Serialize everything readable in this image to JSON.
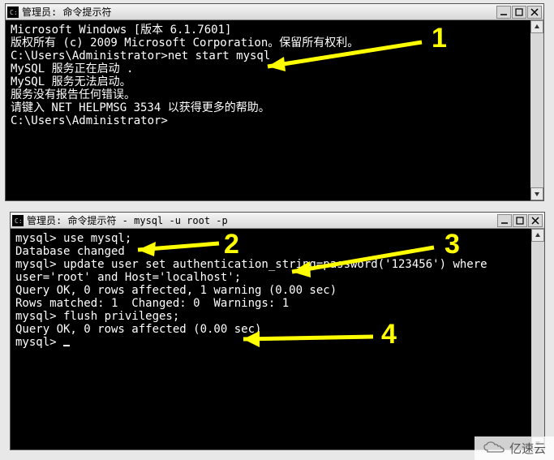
{
  "windows": [
    {
      "title": "管理员: 命令提示符",
      "lines": [
        "Microsoft Windows [版本 6.1.7601]",
        "版权所有 (c) 2009 Microsoft Corporation。保留所有权利。",
        "",
        "C:\\Users\\Administrator>net start mysql",
        "MySQL 服务正在启动 .",
        "MySQL 服务无法启动。",
        "",
        "服务没有报告任何错误。",
        "",
        "请键入 NET HELPMSG 3534 以获得更多的帮助。",
        "",
        "",
        "C:\\Users\\Administrator>"
      ]
    },
    {
      "title": "管理员: 命令提示符 - mysql  -u root -p",
      "lines": [
        "mysql> use mysql;",
        "Database changed",
        "mysql> update user set authentication_string=password('123456') where user='root' and Host='localhost';",
        "Query OK, 0 rows affected, 1 warning (0.00 sec)",
        "Rows matched: 1  Changed: 0  Warnings: 1",
        "",
        "mysql> flush privileges;",
        "Query OK, 0 rows affected (0.00 sec)",
        "",
        "mysql> "
      ]
    }
  ],
  "annotations": {
    "a1": "1",
    "a2": "2",
    "a3": "3",
    "a4": "4"
  },
  "watermark": "亿速云"
}
